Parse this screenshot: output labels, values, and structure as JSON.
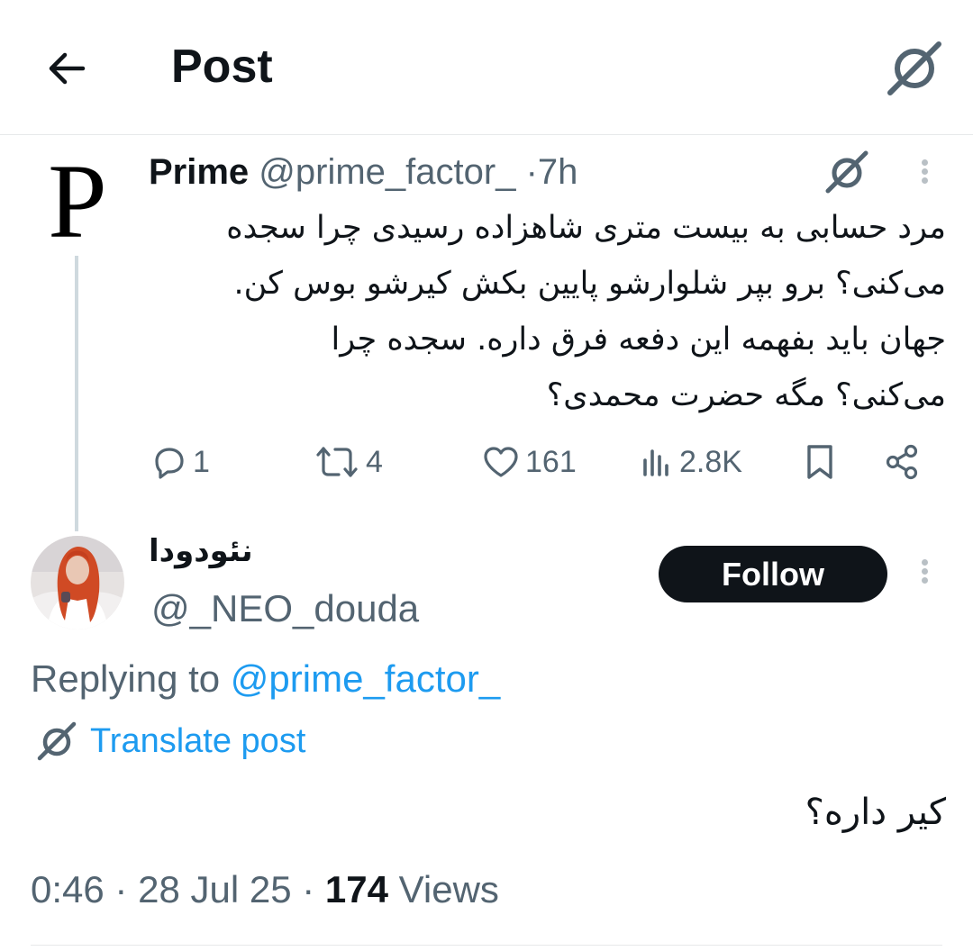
{
  "header": {
    "title": "Post",
    "back_icon": "arrow-left-icon",
    "grok_icon": "grok-icon"
  },
  "original_post": {
    "avatar_letter": "P",
    "display_name": "Prime",
    "handle": "@prime_factor_",
    "separator": "·",
    "time": "7h",
    "lines": [
      "مرد حسابی به بیست متری شاهزاده رسیدی چرا سجده",
      "می‌کنی؟ برو بپر شلوارشو پایین بکش کیرشو بوس کن.",
      "جهان باید بفهمه این دفعه فرق داره. سجده چرا",
      "می‌کنی؟ مگه حضرت محمدی؟"
    ],
    "actions": {
      "replies": "1",
      "reposts": "4",
      "likes": "161",
      "views": "2.8K"
    }
  },
  "reply": {
    "display_name": "نئودودا",
    "handle": "@_NEO_douda",
    "follow_label": "Follow",
    "replying_prefix": "Replying to",
    "replying_to": "@prime_factor_",
    "translate_label": "Translate post",
    "text": "کیر داره؟",
    "time": "0:46",
    "date": "28 Jul 25",
    "views_count": "174",
    "views_label": "Views",
    "separator": "·"
  },
  "colors": {
    "text": "#0f1419",
    "secondary": "#536471",
    "accent": "#1d9bf0",
    "divider": "#e7e9ea",
    "follow_bg": "#0f1419"
  }
}
